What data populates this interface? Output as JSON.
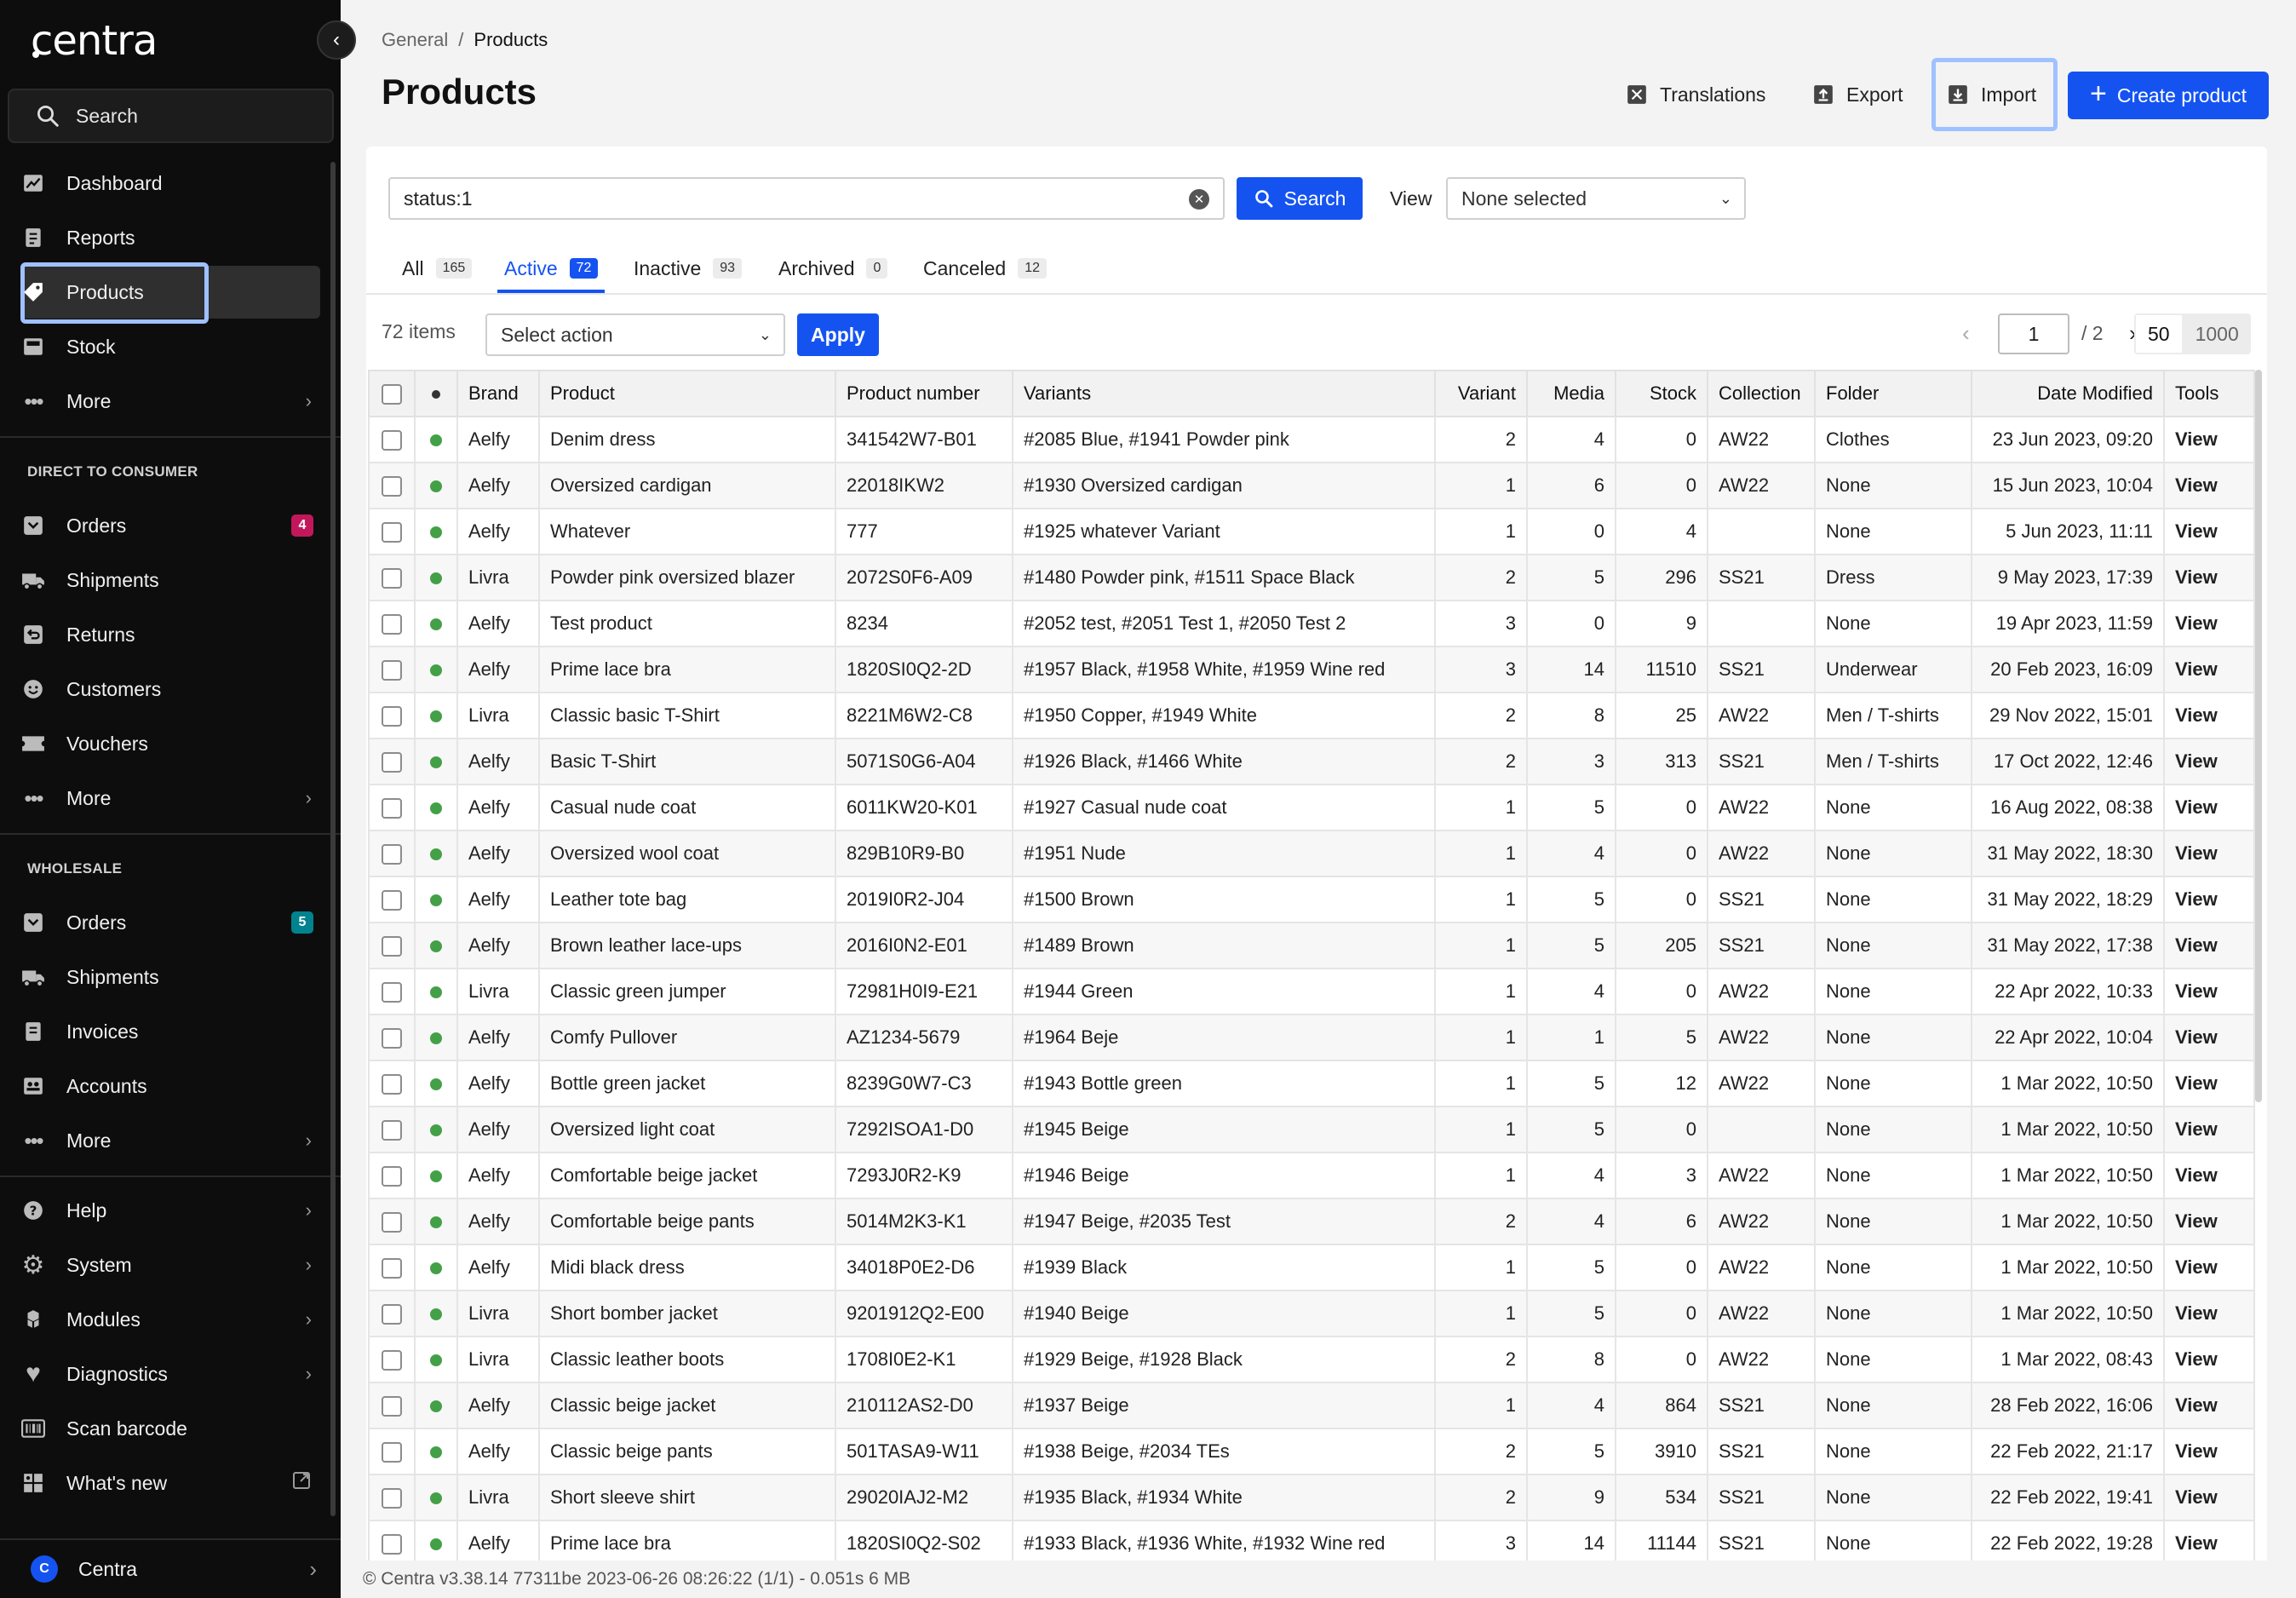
{
  "sidebar": {
    "logo": "centra",
    "search_label": "Search",
    "top_items": [
      {
        "label": "Dashboard",
        "icon": "chart-icon"
      },
      {
        "label": "Reports",
        "icon": "reports-icon"
      },
      {
        "label": "Products",
        "icon": "tag-icon",
        "active": true
      },
      {
        "label": "Stock",
        "icon": "stock-icon"
      },
      {
        "label": "More",
        "icon": "more-icon"
      }
    ],
    "dtc": {
      "title": "DIRECT TO CONSUMER",
      "items": [
        {
          "label": "Orders",
          "icon": "orders-icon",
          "badge": "4",
          "badge_color": "#c2185b"
        },
        {
          "label": "Shipments",
          "icon": "truck-icon"
        },
        {
          "label": "Returns",
          "icon": "returns-icon"
        },
        {
          "label": "Customers",
          "icon": "smiley-icon"
        },
        {
          "label": "Vouchers",
          "icon": "voucher-icon"
        },
        {
          "label": "More",
          "icon": "more-icon"
        }
      ]
    },
    "wholesale": {
      "title": "WHOLESALE",
      "items": [
        {
          "label": "Orders",
          "icon": "orders-icon",
          "badge": "5",
          "badge_color": "#00838f"
        },
        {
          "label": "Shipments",
          "icon": "truck-icon"
        },
        {
          "label": "Invoices",
          "icon": "invoice-icon"
        },
        {
          "label": "Accounts",
          "icon": "accounts-icon"
        },
        {
          "label": "More",
          "icon": "more-icon"
        }
      ]
    },
    "bottom_items": [
      {
        "label": "Help",
        "icon": "help-icon"
      },
      {
        "label": "System",
        "icon": "gear-icon"
      },
      {
        "label": "Modules",
        "icon": "modules-icon"
      },
      {
        "label": "Diagnostics",
        "icon": "heart-icon"
      },
      {
        "label": "Scan barcode",
        "icon": "barcode-icon"
      },
      {
        "label": "What's new",
        "icon": "news-icon"
      }
    ],
    "account": {
      "label": "Centra",
      "initial": "C"
    }
  },
  "header": {
    "breadcrumb": {
      "parent": "General",
      "separator": "/",
      "current": "Products"
    },
    "title": "Products",
    "buttons": {
      "translations": "Translations",
      "export": "Export",
      "import": "Import",
      "create": "Create product"
    }
  },
  "filter": {
    "query": "status:1",
    "search_label": "Search",
    "view_label": "View",
    "view_value": "None selected"
  },
  "tabs": [
    {
      "label": "All",
      "count": "165"
    },
    {
      "label": "Active",
      "count": "72",
      "active": true
    },
    {
      "label": "Inactive",
      "count": "93"
    },
    {
      "label": "Archived",
      "count": "0"
    },
    {
      "label": "Canceled",
      "count": "12"
    }
  ],
  "toolbar": {
    "items_count": "72 items",
    "action_placeholder": "Select action",
    "apply_label": "Apply",
    "page": "1",
    "page_total": "/ 2",
    "page_sizes": [
      "50",
      "1000"
    ],
    "page_size_selected": "50"
  },
  "table": {
    "columns": [
      "Brand",
      "Product",
      "Product number",
      "Variants",
      "Variant",
      "Media",
      "Stock",
      "Collection",
      "Folder",
      "Date Modified",
      "Tools"
    ],
    "status_color": "#43a047",
    "rows": [
      [
        "Aelfy",
        "Denim dress",
        "341542W7-B01",
        "#2085 Blue, #1941 Powder pink",
        "2",
        "4",
        "0",
        "AW22",
        "Clothes",
        "23 Jun 2023, 09:20",
        "View"
      ],
      [
        "Aelfy",
        "Oversized cardigan",
        "22018IKW2",
        "#1930 Oversized cardigan",
        "1",
        "6",
        "0",
        "AW22",
        "None",
        "15 Jun 2023, 10:04",
        "View"
      ],
      [
        "Aelfy",
        "Whatever",
        "777",
        "#1925 whatever Variant",
        "1",
        "0",
        "4",
        "",
        "None",
        "5 Jun 2023, 11:11",
        "View"
      ],
      [
        "Livra",
        "Powder pink oversized blazer",
        "2072S0F6-A09",
        "#1480 Powder pink, #1511 Space Black",
        "2",
        "5",
        "296",
        "SS21",
        "Dress",
        "9 May 2023, 17:39",
        "View"
      ],
      [
        "Aelfy",
        "Test product",
        "8234",
        "#2052 test, #2051 Test 1, #2050 Test 2",
        "3",
        "0",
        "9",
        "",
        "None",
        "19 Apr 2023, 11:59",
        "View"
      ],
      [
        "Aelfy",
        "Prime lace bra",
        "1820SI0Q2-2D",
        "#1957 Black, #1958 White, #1959 Wine red",
        "3",
        "14",
        "11510",
        "SS21",
        "Underwear",
        "20 Feb 2023, 16:09",
        "View"
      ],
      [
        "Livra",
        "Classic basic T-Shirt",
        "8221M6W2-C8",
        "#1950 Copper, #1949 White",
        "2",
        "8",
        "25",
        "AW22",
        "Men / T-shirts",
        "29 Nov 2022, 15:01",
        "View"
      ],
      [
        "Aelfy",
        "Basic T-Shirt",
        "5071S0G6-A04",
        "#1926 Black, #1466 White",
        "2",
        "3",
        "313",
        "SS21",
        "Men / T-shirts",
        "17 Oct 2022, 12:46",
        "View"
      ],
      [
        "Aelfy",
        "Casual nude coat",
        "6011KW20-K01",
        "#1927 Casual nude coat",
        "1",
        "5",
        "0",
        "AW22",
        "None",
        "16 Aug 2022, 08:38",
        "View"
      ],
      [
        "Aelfy",
        "Oversized wool coat",
        "829B10R9-B0",
        "#1951 Nude",
        "1",
        "4",
        "0",
        "AW22",
        "None",
        "31 May 2022, 18:30",
        "View"
      ],
      [
        "Aelfy",
        "Leather tote bag",
        "2019I0R2-J04",
        "#1500 Brown",
        "1",
        "5",
        "0",
        "SS21",
        "None",
        "31 May 2022, 18:29",
        "View"
      ],
      [
        "Aelfy",
        "Brown leather lace-ups",
        "2016I0N2-E01",
        "#1489 Brown",
        "1",
        "5",
        "205",
        "SS21",
        "None",
        "31 May 2022, 17:38",
        "View"
      ],
      [
        "Livra",
        "Classic green jumper",
        "72981H0I9-E21",
        "#1944 Green",
        "1",
        "4",
        "0",
        "AW22",
        "None",
        "22 Apr 2022, 10:33",
        "View"
      ],
      [
        "Aelfy",
        "Comfy Pullover",
        "AZ1234-5679",
        "#1964 Beje",
        "1",
        "1",
        "5",
        "AW22",
        "None",
        "22 Apr 2022, 10:04",
        "View"
      ],
      [
        "Aelfy",
        "Bottle green jacket",
        "8239G0W7-C3",
        "#1943 Bottle green",
        "1",
        "5",
        "12",
        "AW22",
        "None",
        "1 Mar 2022, 10:50",
        "View"
      ],
      [
        "Aelfy",
        "Oversized light coat",
        "7292ISOA1-D0",
        "#1945 Beige",
        "1",
        "5",
        "0",
        "",
        "None",
        "1 Mar 2022, 10:50",
        "View"
      ],
      [
        "Aelfy",
        "Comfortable beige jacket",
        "7293J0R2-K9",
        "#1946 Beige",
        "1",
        "4",
        "3",
        "AW22",
        "None",
        "1 Mar 2022, 10:50",
        "View"
      ],
      [
        "Aelfy",
        "Comfortable beige pants",
        "5014M2K3-K1",
        "#1947 Beige, #2035 Test",
        "2",
        "4",
        "6",
        "AW22",
        "None",
        "1 Mar 2022, 10:50",
        "View"
      ],
      [
        "Aelfy",
        "Midi black dress",
        "34018P0E2-D6",
        "#1939 Black",
        "1",
        "5",
        "0",
        "AW22",
        "None",
        "1 Mar 2022, 10:50",
        "View"
      ],
      [
        "Livra",
        "Short bomber jacket",
        "9201912Q2-E00",
        "#1940 Beige",
        "1",
        "5",
        "0",
        "AW22",
        "None",
        "1 Mar 2022, 10:50",
        "View"
      ],
      [
        "Livra",
        "Classic leather boots",
        "1708I0E2-K1",
        "#1929 Beige, #1928 Black",
        "2",
        "8",
        "0",
        "AW22",
        "None",
        "1 Mar 2022, 08:43",
        "View"
      ],
      [
        "Aelfy",
        "Classic beige jacket",
        "210112AS2-D0",
        "#1937 Beige",
        "1",
        "4",
        "864",
        "SS21",
        "None",
        "28 Feb 2022, 16:06",
        "View"
      ],
      [
        "Aelfy",
        "Classic beige pants",
        "501TASA9-W11",
        "#1938 Beige, #2034 TEs",
        "2",
        "5",
        "3910",
        "SS21",
        "None",
        "22 Feb 2022, 21:17",
        "View"
      ],
      [
        "Livra",
        "Short sleeve shirt",
        "29020IAJ2-M2",
        "#1935 Black, #1934 White",
        "2",
        "9",
        "534",
        "SS21",
        "None",
        "22 Feb 2022, 19:41",
        "View"
      ],
      [
        "Aelfy",
        "Prime lace bra",
        "1820SI0Q2-S02",
        "#1933 Black, #1936 White, #1932 Wine red",
        "3",
        "14",
        "11144",
        "SS21",
        "None",
        "22 Feb 2022, 19:28",
        "View"
      ]
    ]
  },
  "footer": "© Centra v3.38.14 77311be 2023-06-26 08:26:22 (1/1) - 0.051s 6 MB",
  "colors": {
    "accent": "#1553f1",
    "sidebar_bg": "#0d0d0d",
    "highlight": "#9fc1ff"
  }
}
